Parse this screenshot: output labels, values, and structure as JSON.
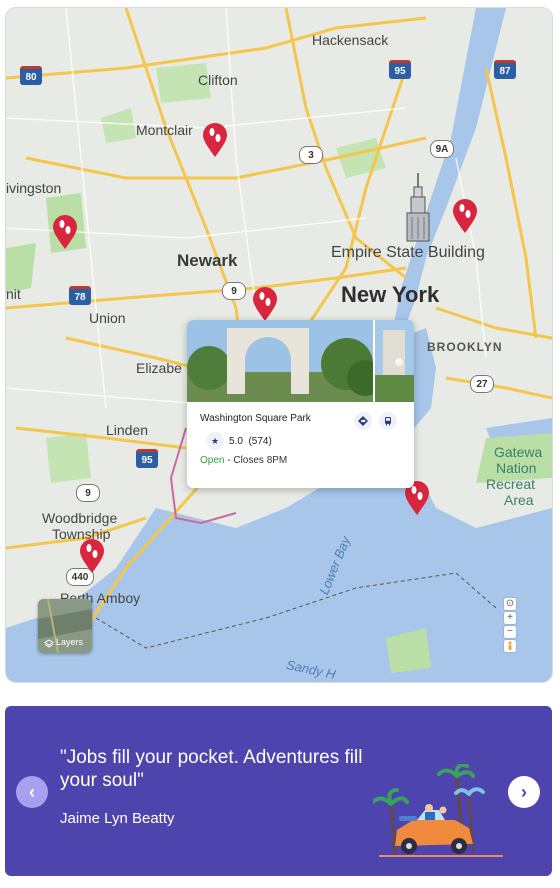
{
  "map": {
    "places": [
      "Hackensack",
      "Clifton",
      "Montclair",
      "Livingston",
      "Newark",
      "New York",
      "Empire State Building",
      "Union",
      "Elizabeth",
      "Linden",
      "BROOKLYN",
      "Woodbridge Township",
      "Perth Amboy",
      "Gateway National Recreation Area",
      "Lower Bay",
      "Sandy Hook",
      "Summit"
    ],
    "labels": {
      "hackensack": "Hackensack",
      "clifton": "Clifton",
      "montclair": "Montclair",
      "livingston": "ivingston",
      "newark": "Newark",
      "new_york": "New York",
      "empire": "Empire State Building",
      "summit": "nit",
      "union": "Union",
      "elizabeth": "Elizabe",
      "linden": "Linden",
      "brooklyn": "BROOKLYN",
      "woodbridge_1": "Woodbridge",
      "woodbridge_2": "Township",
      "perth": "Perth Amboy",
      "gateway_1": "Gatewa",
      "gateway_2": "Nation",
      "gateway_3": "Recreat",
      "gateway_4": "Area",
      "lower_bay": "Lower Bay",
      "sandy": "Sandy H"
    },
    "shields": {
      "i80": "80",
      "i95_top": "95",
      "i87": "87",
      "r3": "3",
      "r9a": "9A",
      "i78": "78",
      "us9_top": "9",
      "r27": "27",
      "i95_bot": "95",
      "us9_bot": "9",
      "r440": "440"
    },
    "layers_label": "Layers",
    "zoom_controls": [
      "⊙",
      "+",
      "−"
    ]
  },
  "place_card": {
    "name": "Washington Square Park",
    "rating": "5.0",
    "reviews": "(574)",
    "open_status": "Open",
    "closes": " - Closes 8PM"
  },
  "banner": {
    "quote": "\"Jobs fill your pocket. Adventures fill your soul\"",
    "author": "Jaime Lyn Beatty",
    "prev_icon": "‹",
    "next_icon": "›"
  },
  "colors": {
    "banner_bg": "#4e44ad",
    "pin_red": "#d7263d",
    "water": "#a7c6ea",
    "park": "#b9dfa6",
    "road": "#f4c64c"
  }
}
